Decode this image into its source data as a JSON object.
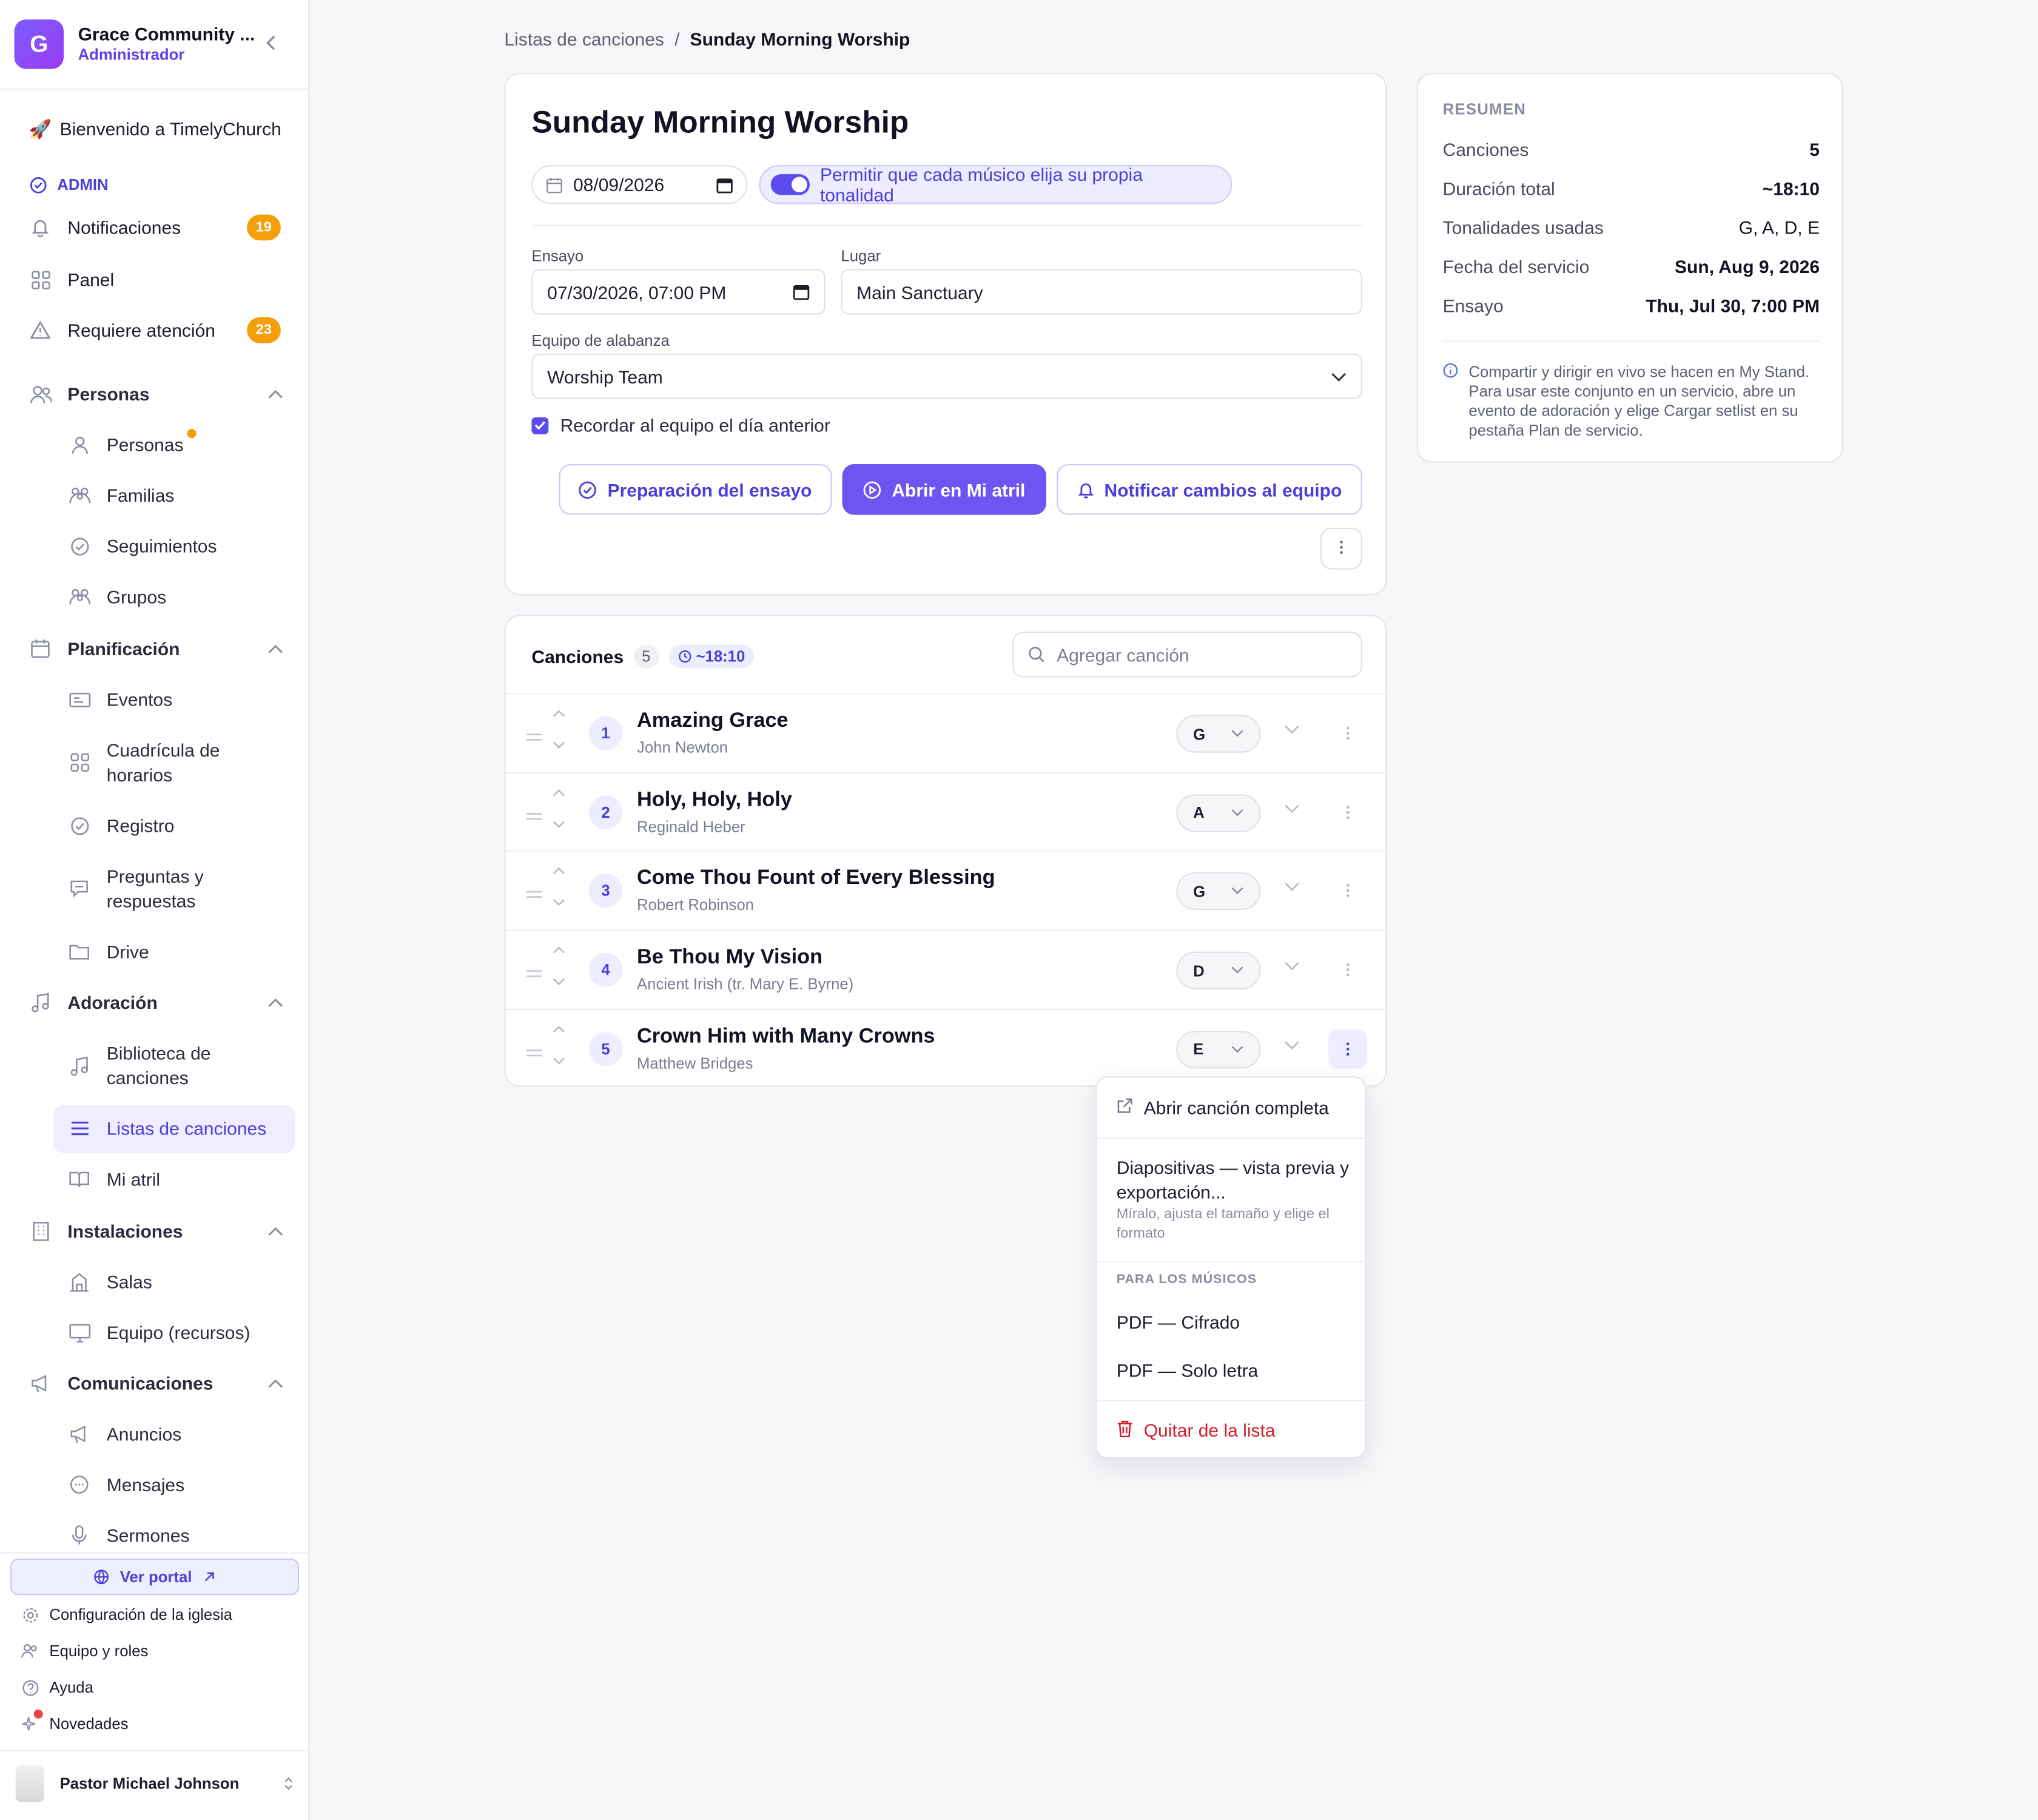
{
  "org": {
    "initial": "G",
    "name": "Grace Community ...",
    "role": "Administrador"
  },
  "welcome": "Bienvenido a TimelyChurch",
  "admin_label": "ADMIN",
  "nav_top": [
    {
      "label": "Notificaciones",
      "badge": "19"
    },
    {
      "label": "Panel"
    },
    {
      "label": "Requiere atención",
      "badge": "23"
    }
  ],
  "sections": {
    "personas": {
      "label": "Personas",
      "items": [
        "Personas",
        "Familias",
        "Seguimientos",
        "Grupos"
      ]
    },
    "planificacion": {
      "label": "Planificación",
      "items": [
        "Eventos",
        "Cuadrícula de horarios",
        "Registro",
        "Preguntas y respuestas",
        "Drive"
      ]
    },
    "adoracion": {
      "label": "Adoración",
      "items": [
        "Biblioteca de canciones",
        "Listas de canciones",
        "Mi atril"
      ]
    },
    "instalaciones": {
      "label": "Instalaciones",
      "items": [
        "Salas",
        "Equipo (recursos)"
      ]
    },
    "comunicaciones": {
      "label": "Comunicaciones",
      "items": [
        "Anuncios",
        "Mensajes",
        "Sermones"
      ]
    }
  },
  "portal_label": "Ver portal",
  "bottom_links": [
    "Configuración de la iglesia",
    "Equipo y roles",
    "Ayuda",
    "Novedades"
  ],
  "user_name": "Pastor Michael Johnson",
  "breadcrumb": {
    "parent": "Listas de canciones",
    "separator": "/",
    "current": "Sunday Morning Worship"
  },
  "setlist": {
    "title": "Sunday Morning Worship",
    "date": "08/09/2026",
    "toggle_label": "Permitir que cada músico elija su propia tonalidad",
    "rehearsal_label": "Ensayo",
    "rehearsal_value": "07/30/2026, 07:00 PM",
    "place_label": "Lugar",
    "place_value": "Main Sanctuary",
    "team_label": "Equipo de alabanza",
    "team_value": "Worship Team",
    "reminder_label": "Recordar al equipo el día anterior",
    "btn_prep": "Preparación del ensayo",
    "btn_open": "Abrir en Mi atril",
    "btn_notify": "Notificar cambios al equipo"
  },
  "songs": {
    "header": "Canciones",
    "count": "5",
    "duration": "~18:10",
    "search_placeholder": "Agregar canción",
    "items": [
      {
        "num": "1",
        "title": "Amazing Grace",
        "author": "John Newton",
        "key": "G"
      },
      {
        "num": "2",
        "title": "Holy, Holy, Holy",
        "author": "Reginald Heber",
        "key": "A"
      },
      {
        "num": "3",
        "title": "Come Thou Fount of Every Blessing",
        "author": "Robert Robinson",
        "key": "G"
      },
      {
        "num": "4",
        "title": "Be Thou My Vision",
        "author": "Ancient Irish (tr. Mary E. Byrne)",
        "key": "D"
      },
      {
        "num": "5",
        "title": "Crown Him with Many Crowns",
        "author": "Matthew Bridges",
        "key": "E"
      }
    ]
  },
  "summary": {
    "title": "RESUMEN",
    "rows": [
      {
        "label": "Canciones",
        "value": "5"
      },
      {
        "label": "Duración total",
        "value": "~18:10"
      },
      {
        "label": "Tonalidades usadas",
        "value": "G, A, D, E"
      },
      {
        "label": "Fecha del servicio",
        "value": "Sun, Aug 9, 2026"
      },
      {
        "label": "Ensayo",
        "value": "Thu, Jul 30, 7:00 PM"
      }
    ],
    "note": "Compartir y dirigir en vivo se hacen en My Stand. Para usar este conjunto en un servicio, abre un evento de adoración y elige Cargar setlist en su pestaña Plan de servicio."
  },
  "menu": {
    "open_full": "Abrir canción completa",
    "slides": "Diapositivas — vista previa y exportación...",
    "slides_sub": "Míralo, ajusta el tamaño y elige el formato",
    "musicians_header": "PARA LOS MÚSICOS",
    "pdf_chords": "PDF — Cifrado",
    "pdf_lyrics": "PDF — Solo letra",
    "remove": "Quitar de la lista"
  },
  "colors": {
    "accent": "#6c55f0",
    "badge": "#f59e0b",
    "danger": "#d01f2f"
  }
}
